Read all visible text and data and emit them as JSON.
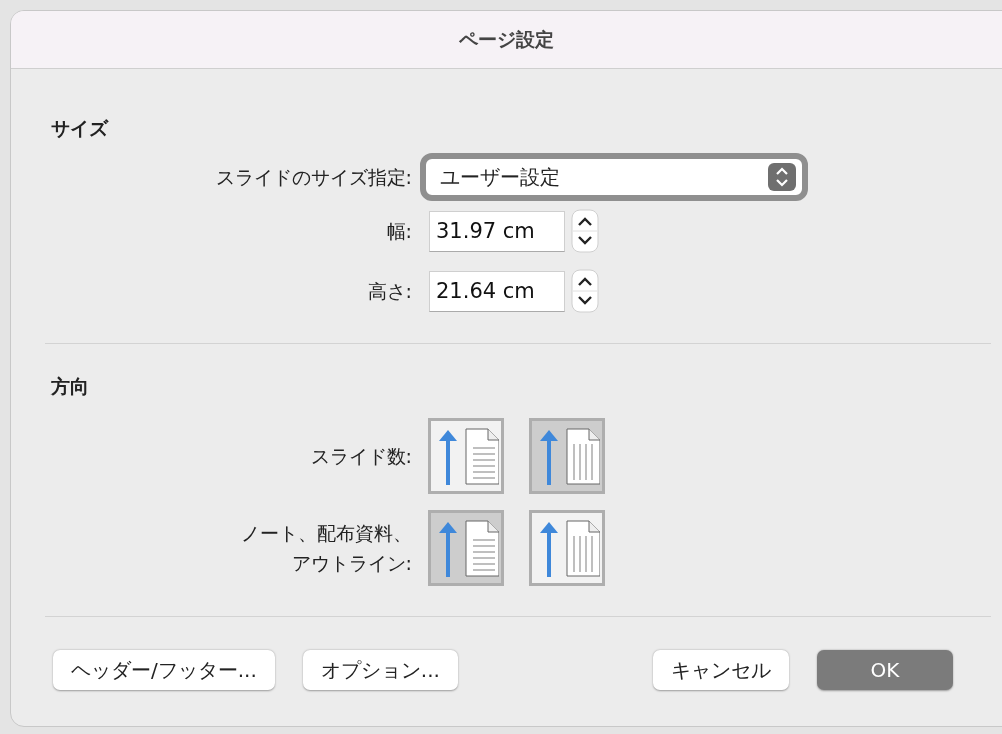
{
  "window": {
    "title": "ページ設定"
  },
  "size_section": {
    "heading": "サイズ",
    "slide_size": {
      "label": "スライドのサイズ指定:",
      "value": "ユーザー設定"
    },
    "width": {
      "label": "幅:",
      "value": "31.97 cm"
    },
    "height": {
      "label": "高さ:",
      "value": "21.64 cm"
    }
  },
  "orientation_section": {
    "heading": "方向",
    "rows": [
      {
        "label_lines": [
          "スライド数:"
        ],
        "options": [
          {
            "kind": "portrait",
            "selected": false
          },
          {
            "kind": "landscape",
            "selected": true
          }
        ]
      },
      {
        "label_lines": [
          "ノート、配布資料、",
          "アウトライン:"
        ],
        "options": [
          {
            "kind": "portrait",
            "selected": true
          },
          {
            "kind": "landscape",
            "selected": false
          }
        ]
      }
    ]
  },
  "left_buttons": [
    {
      "label": "ヘッダー/フッター...",
      "default": false
    },
    {
      "label": "オプション...",
      "default": false
    }
  ],
  "right_buttons": [
    {
      "label": "キャンセル",
      "default": false
    },
    {
      "label": "OK",
      "default": true
    }
  ]
}
